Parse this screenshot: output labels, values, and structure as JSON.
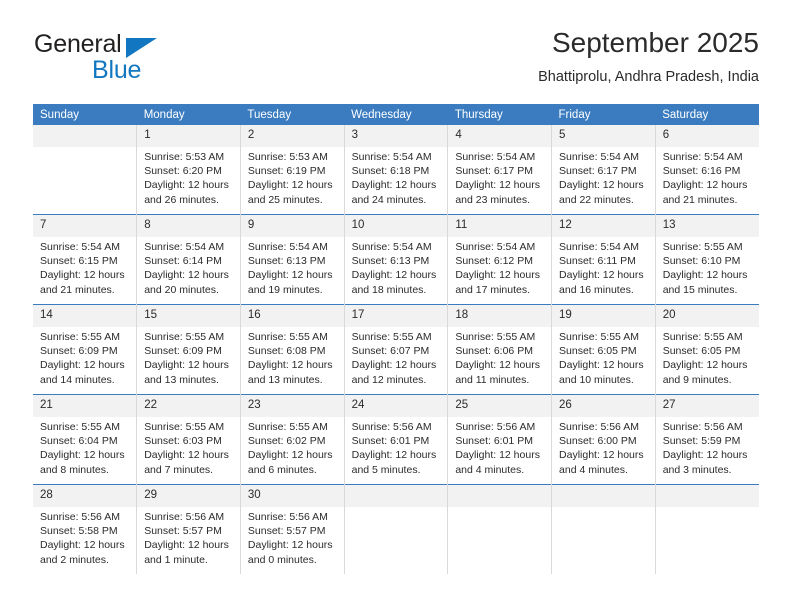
{
  "brand": {
    "name_part1": "General",
    "name_part2": "Blue",
    "accent_color": "#1277c0"
  },
  "header": {
    "title": "September 2025",
    "subtitle": "Bhattiprolu, Andhra Pradesh, India"
  },
  "theme": {
    "header_blue": "#3b7cc0",
    "daynum_band": "#f2f2f2",
    "text": "#2b2b2b"
  },
  "columns": [
    "Sunday",
    "Monday",
    "Tuesday",
    "Wednesday",
    "Thursday",
    "Friday",
    "Saturday"
  ],
  "labels": {
    "sunrise": "Sunrise:",
    "sunset": "Sunset:",
    "daylight": "Daylight:"
  },
  "weeks": [
    [
      {
        "day": "",
        "sunrise": "",
        "sunset": "",
        "daylight": ""
      },
      {
        "day": "1",
        "sunrise": "Sunrise: 5:53 AM",
        "sunset": "Sunset: 6:20 PM",
        "daylight": "Daylight: 12 hours and 26 minutes."
      },
      {
        "day": "2",
        "sunrise": "Sunrise: 5:53 AM",
        "sunset": "Sunset: 6:19 PM",
        "daylight": "Daylight: 12 hours and 25 minutes."
      },
      {
        "day": "3",
        "sunrise": "Sunrise: 5:54 AM",
        "sunset": "Sunset: 6:18 PM",
        "daylight": "Daylight: 12 hours and 24 minutes."
      },
      {
        "day": "4",
        "sunrise": "Sunrise: 5:54 AM",
        "sunset": "Sunset: 6:17 PM",
        "daylight": "Daylight: 12 hours and 23 minutes."
      },
      {
        "day": "5",
        "sunrise": "Sunrise: 5:54 AM",
        "sunset": "Sunset: 6:17 PM",
        "daylight": "Daylight: 12 hours and 22 minutes."
      },
      {
        "day": "6",
        "sunrise": "Sunrise: 5:54 AM",
        "sunset": "Sunset: 6:16 PM",
        "daylight": "Daylight: 12 hours and 21 minutes."
      }
    ],
    [
      {
        "day": "7",
        "sunrise": "Sunrise: 5:54 AM",
        "sunset": "Sunset: 6:15 PM",
        "daylight": "Daylight: 12 hours and 21 minutes."
      },
      {
        "day": "8",
        "sunrise": "Sunrise: 5:54 AM",
        "sunset": "Sunset: 6:14 PM",
        "daylight": "Daylight: 12 hours and 20 minutes."
      },
      {
        "day": "9",
        "sunrise": "Sunrise: 5:54 AM",
        "sunset": "Sunset: 6:13 PM",
        "daylight": "Daylight: 12 hours and 19 minutes."
      },
      {
        "day": "10",
        "sunrise": "Sunrise: 5:54 AM",
        "sunset": "Sunset: 6:13 PM",
        "daylight": "Daylight: 12 hours and 18 minutes."
      },
      {
        "day": "11",
        "sunrise": "Sunrise: 5:54 AM",
        "sunset": "Sunset: 6:12 PM",
        "daylight": "Daylight: 12 hours and 17 minutes."
      },
      {
        "day": "12",
        "sunrise": "Sunrise: 5:54 AM",
        "sunset": "Sunset: 6:11 PM",
        "daylight": "Daylight: 12 hours and 16 minutes."
      },
      {
        "day": "13",
        "sunrise": "Sunrise: 5:55 AM",
        "sunset": "Sunset: 6:10 PM",
        "daylight": "Daylight: 12 hours and 15 minutes."
      }
    ],
    [
      {
        "day": "14",
        "sunrise": "Sunrise: 5:55 AM",
        "sunset": "Sunset: 6:09 PM",
        "daylight": "Daylight: 12 hours and 14 minutes."
      },
      {
        "day": "15",
        "sunrise": "Sunrise: 5:55 AM",
        "sunset": "Sunset: 6:09 PM",
        "daylight": "Daylight: 12 hours and 13 minutes."
      },
      {
        "day": "16",
        "sunrise": "Sunrise: 5:55 AM",
        "sunset": "Sunset: 6:08 PM",
        "daylight": "Daylight: 12 hours and 13 minutes."
      },
      {
        "day": "17",
        "sunrise": "Sunrise: 5:55 AM",
        "sunset": "Sunset: 6:07 PM",
        "daylight": "Daylight: 12 hours and 12 minutes."
      },
      {
        "day": "18",
        "sunrise": "Sunrise: 5:55 AM",
        "sunset": "Sunset: 6:06 PM",
        "daylight": "Daylight: 12 hours and 11 minutes."
      },
      {
        "day": "19",
        "sunrise": "Sunrise: 5:55 AM",
        "sunset": "Sunset: 6:05 PM",
        "daylight": "Daylight: 12 hours and 10 minutes."
      },
      {
        "day": "20",
        "sunrise": "Sunrise: 5:55 AM",
        "sunset": "Sunset: 6:05 PM",
        "daylight": "Daylight: 12 hours and 9 minutes."
      }
    ],
    [
      {
        "day": "21",
        "sunrise": "Sunrise: 5:55 AM",
        "sunset": "Sunset: 6:04 PM",
        "daylight": "Daylight: 12 hours and 8 minutes."
      },
      {
        "day": "22",
        "sunrise": "Sunrise: 5:55 AM",
        "sunset": "Sunset: 6:03 PM",
        "daylight": "Daylight: 12 hours and 7 minutes."
      },
      {
        "day": "23",
        "sunrise": "Sunrise: 5:55 AM",
        "sunset": "Sunset: 6:02 PM",
        "daylight": "Daylight: 12 hours and 6 minutes."
      },
      {
        "day": "24",
        "sunrise": "Sunrise: 5:56 AM",
        "sunset": "Sunset: 6:01 PM",
        "daylight": "Daylight: 12 hours and 5 minutes."
      },
      {
        "day": "25",
        "sunrise": "Sunrise: 5:56 AM",
        "sunset": "Sunset: 6:01 PM",
        "daylight": "Daylight: 12 hours and 4 minutes."
      },
      {
        "day": "26",
        "sunrise": "Sunrise: 5:56 AM",
        "sunset": "Sunset: 6:00 PM",
        "daylight": "Daylight: 12 hours and 4 minutes."
      },
      {
        "day": "27",
        "sunrise": "Sunrise: 5:56 AM",
        "sunset": "Sunset: 5:59 PM",
        "daylight": "Daylight: 12 hours and 3 minutes."
      }
    ],
    [
      {
        "day": "28",
        "sunrise": "Sunrise: 5:56 AM",
        "sunset": "Sunset: 5:58 PM",
        "daylight": "Daylight: 12 hours and 2 minutes."
      },
      {
        "day": "29",
        "sunrise": "Sunrise: 5:56 AM",
        "sunset": "Sunset: 5:57 PM",
        "daylight": "Daylight: 12 hours and 1 minute."
      },
      {
        "day": "30",
        "sunrise": "Sunrise: 5:56 AM",
        "sunset": "Sunset: 5:57 PM",
        "daylight": "Daylight: 12 hours and 0 minutes."
      },
      {
        "day": "",
        "sunrise": "",
        "sunset": "",
        "daylight": ""
      },
      {
        "day": "",
        "sunrise": "",
        "sunset": "",
        "daylight": ""
      },
      {
        "day": "",
        "sunrise": "",
        "sunset": "",
        "daylight": ""
      },
      {
        "day": "",
        "sunrise": "",
        "sunset": "",
        "daylight": ""
      }
    ]
  ]
}
